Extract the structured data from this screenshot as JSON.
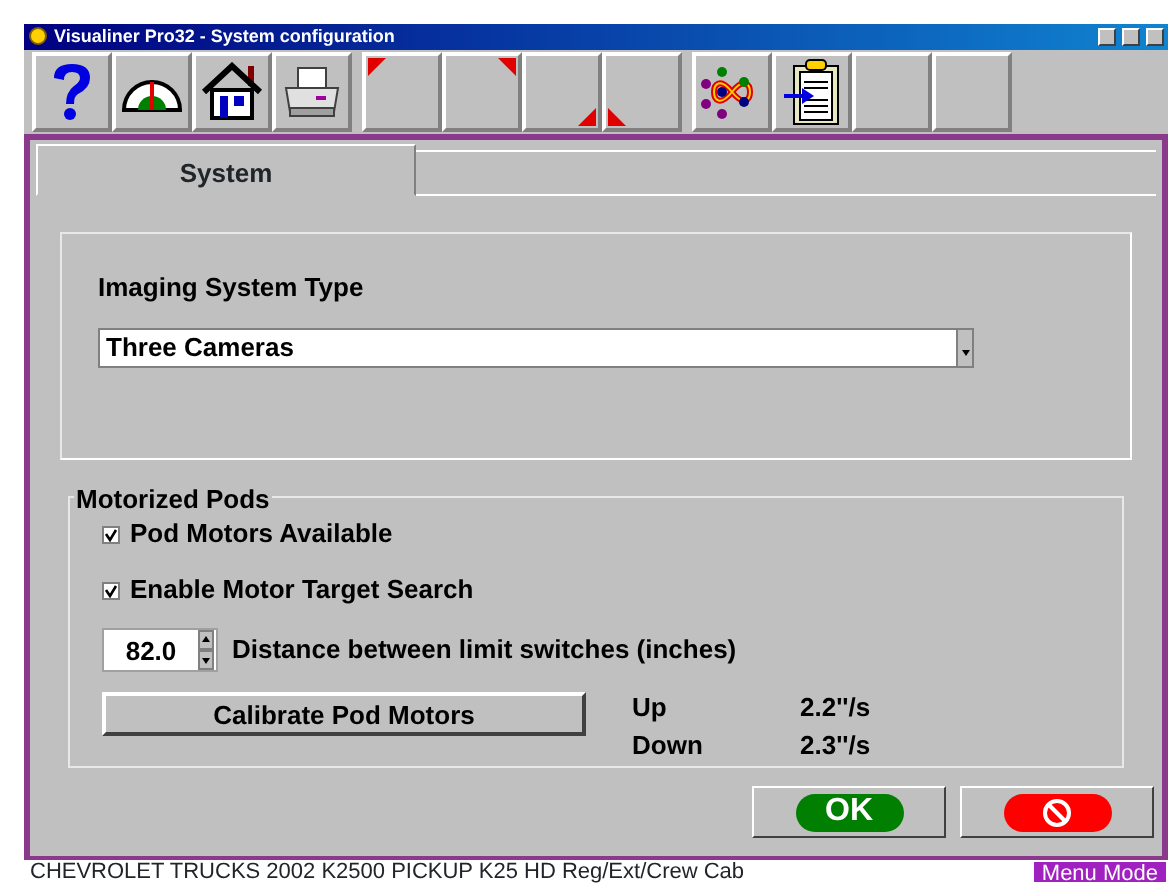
{
  "window": {
    "title": "Visualiner Pro32  -  System configuration"
  },
  "toolbar": [
    {
      "kind": "help"
    },
    {
      "kind": "gauge"
    },
    {
      "kind": "home"
    },
    {
      "kind": "printer"
    },
    {
      "kind": "corner-tl",
      "group_start": true
    },
    {
      "kind": "corner-tr"
    },
    {
      "kind": "corner-br"
    },
    {
      "kind": "corner-bl"
    },
    {
      "kind": "network",
      "group_start": true
    },
    {
      "kind": "clipboard"
    },
    {
      "kind": "blank"
    },
    {
      "kind": "blank"
    }
  ],
  "tabs": [
    {
      "label": "System",
      "selected": true
    }
  ],
  "imaging": {
    "label": "Imaging System Type",
    "value": "Three Cameras"
  },
  "pods": {
    "legend": "Motorized Pods",
    "checkboxes": [
      {
        "label": "Pod Motors Available",
        "checked": true
      },
      {
        "label": "Enable Motor Target Search",
        "checked": true
      }
    ],
    "distance": {
      "value": "82.0",
      "label": "Distance between limit switches (inches)"
    },
    "calibrate": "Calibrate Pod Motors",
    "speeds": [
      {
        "label": "Up",
        "value": "2.2''/s"
      },
      {
        "label": "Down",
        "value": "2.3''/s"
      }
    ]
  },
  "ok_button": {
    "label": "OK"
  },
  "status_bar": {
    "vehicle": "CHEVROLET TRUCKS  2002  K2500 PICKUP  K25 HD Reg/Ext/Crew Cab",
    "mode": "Menu Mode"
  }
}
